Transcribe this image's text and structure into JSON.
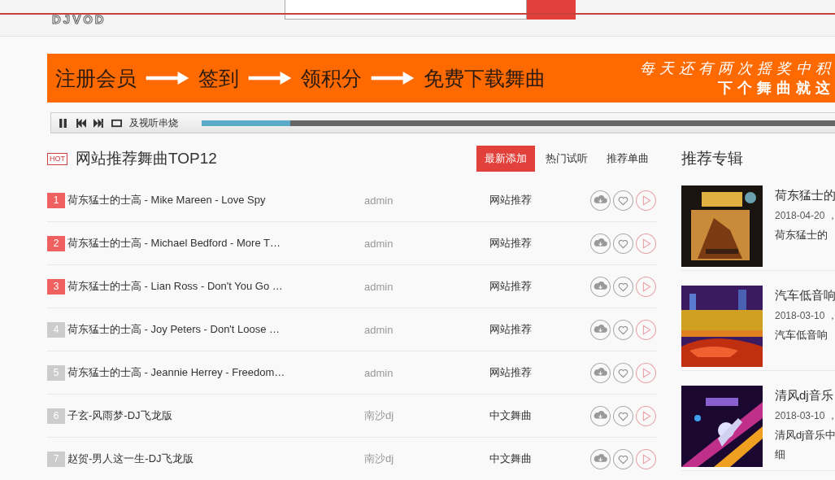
{
  "header": {
    "logo": "DJVOD"
  },
  "banner": {
    "steps": [
      "注册会员",
      "签到",
      "领积分",
      "免费下载舞曲"
    ],
    "promo_lines": [
      "每天还有两次摇奖中积",
      "下个舞曲就这"
    ]
  },
  "player": {
    "track": "及视听串烧",
    "playing": true,
    "level": 0.14
  },
  "section": {
    "title": "网站推荐舞曲TOP12",
    "badge": "HOT",
    "tabs": [
      {
        "label": "最新添加",
        "selected": true
      },
      {
        "label": "热门试听",
        "selected": false
      },
      {
        "label": "推荐单曲",
        "selected": false
      }
    ],
    "rows": [
      {
        "rank": "1",
        "hot": true,
        "title": "荷东猛士的士高 - Mike Mareen - Love Spy",
        "uploader": "admin",
        "category": "网站推荐"
      },
      {
        "rank": "2",
        "hot": true,
        "title": "荷东猛士的士高 - Michael Bedford - More T…",
        "uploader": "admin",
        "category": "网站推荐"
      },
      {
        "rank": "3",
        "hot": true,
        "title": "荷东猛士的士高 - Lian Ross - Don't You Go …",
        "uploader": "admin",
        "category": "网站推荐"
      },
      {
        "rank": "4",
        "hot": false,
        "title": "荷东猛士的士高 - Joy Peters - Don't Loose …",
        "uploader": "admin",
        "category": "网站推荐"
      },
      {
        "rank": "5",
        "hot": false,
        "title": "荷东猛士的士高 - Jeannie Herrey - Freedom…",
        "uploader": "admin",
        "category": "网站推荐"
      },
      {
        "rank": "6",
        "hot": false,
        "title": "子玄-风雨梦-DJ飞龙版",
        "uploader": "南沙dj",
        "category": "中文舞曲"
      },
      {
        "rank": "7",
        "hot": false,
        "title": "赵贺-男人这一生-DJ飞龙版",
        "uploader": "南沙dj",
        "category": "中文舞曲"
      }
    ]
  },
  "albums": {
    "title": "推荐专辑",
    "items": [
      {
        "name": "荷东猛士的",
        "date": "2018-04-20 ，",
        "desc": [
          "荷东猛士的"
        ]
      },
      {
        "name": "汽车低音响",
        "date": "2018-03-10 ，",
        "desc": [
          "汽车低音响"
        ]
      },
      {
        "name": "清风dj音乐",
        "date": "2018-03-10 ，",
        "desc": [
          "清风dj音乐中",
          "细"
        ]
      }
    ]
  }
}
